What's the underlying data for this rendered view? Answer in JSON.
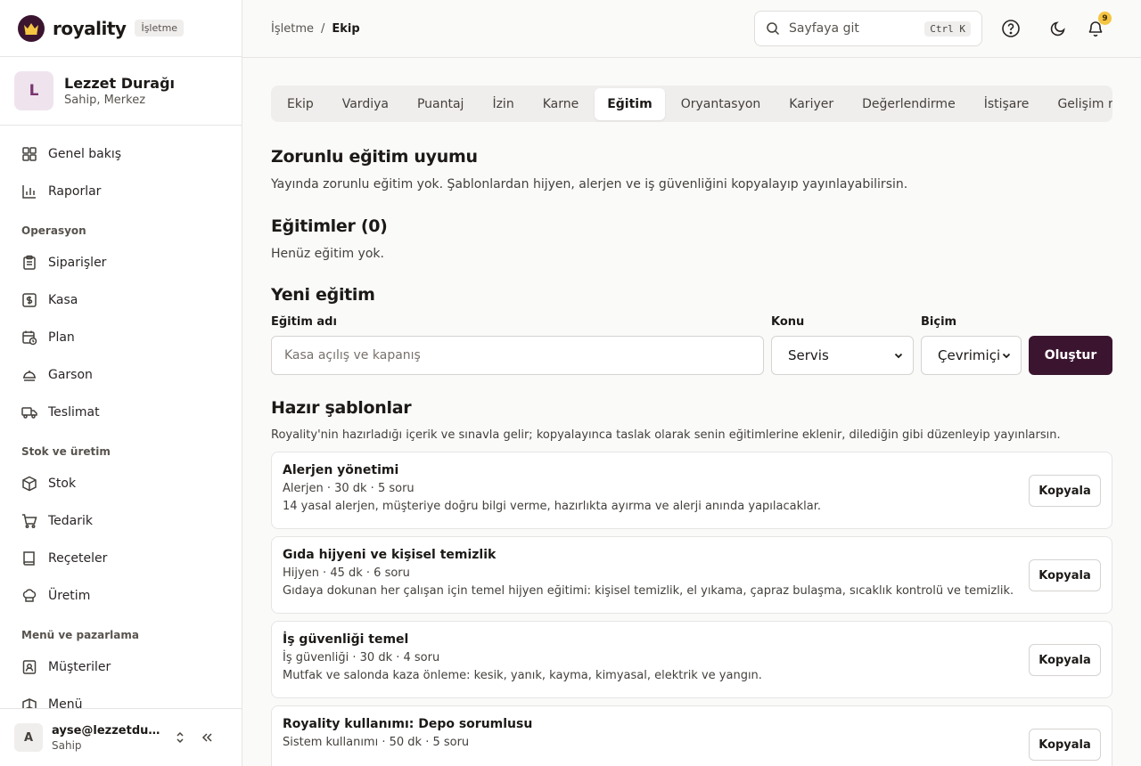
{
  "brand": {
    "name": "royality",
    "badge": "İşletme"
  },
  "org": {
    "initial": "L",
    "name": "Lezzet Durağı",
    "role": "Sahip, Merkez"
  },
  "sidebar": {
    "items_top": [
      {
        "label": "Genel bakış",
        "icon": "dashboard-icon"
      },
      {
        "label": "Raporlar",
        "icon": "bar-chart-icon"
      }
    ],
    "section_operations": "Operasyon",
    "items_operations": [
      {
        "label": "Siparişler",
        "icon": "clipboard-icon"
      },
      {
        "label": "Kasa",
        "icon": "cash-register-icon"
      },
      {
        "label": "Plan",
        "icon": "calendar-clock-icon"
      },
      {
        "label": "Garson",
        "icon": "waiter-icon"
      },
      {
        "label": "Teslimat",
        "icon": "truck-icon"
      }
    ],
    "section_stock": "Stok ve üretim",
    "items_stock": [
      {
        "label": "Stok",
        "icon": "box-icon"
      },
      {
        "label": "Tedarik",
        "icon": "cart-icon"
      },
      {
        "label": "Reçeteler",
        "icon": "book-icon"
      },
      {
        "label": "Üretim",
        "icon": "chef-hat-icon"
      }
    ],
    "section_marketing": "Menü ve pazarlama",
    "items_marketing": [
      {
        "label": "Müşteriler",
        "icon": "contact-icon"
      },
      {
        "label": "Menü",
        "icon": "menu-book-icon"
      }
    ]
  },
  "user": {
    "initial": "A",
    "email": "ayse@lezzetduragi.com",
    "role": "Sahip"
  },
  "header": {
    "breadcrumb_parent": "İşletme",
    "breadcrumb_sep": "/",
    "breadcrumb_current": "Ekip",
    "search_placeholder": "Sayfaya git",
    "search_shortcut": "Ctrl K",
    "notification_count": "9"
  },
  "tabs": [
    {
      "label": "Ekip",
      "active": false
    },
    {
      "label": "Vardiya",
      "active": false
    },
    {
      "label": "Puantaj",
      "active": false
    },
    {
      "label": "İzin",
      "active": false
    },
    {
      "label": "Karne",
      "active": false
    },
    {
      "label": "Eğitim",
      "active": true
    },
    {
      "label": "Oryantasyon",
      "active": false
    },
    {
      "label": "Kariyer",
      "active": false
    },
    {
      "label": "Değerlendirme",
      "active": false
    },
    {
      "label": "İstişare",
      "active": false
    },
    {
      "label": "Gelişim raporu",
      "active": false
    }
  ],
  "compliance": {
    "title": "Zorunlu eğitim uyumu",
    "text": "Yayında zorunlu eğitim yok. Şablonlardan hijyen, alerjen ve iş güvenliğini kopyalayıp yayınlayabilirsin."
  },
  "trainings": {
    "title": "Eğitimler (0)",
    "empty_text": "Henüz eğitim yok."
  },
  "new_training": {
    "title": "Yeni eğitim",
    "name_label": "Eğitim adı",
    "name_placeholder": "Kasa açılış ve kapanış",
    "topic_label": "Konu",
    "topic_value": "Servis",
    "format_label": "Biçim",
    "format_value": "Çevrimiçi",
    "create_label": "Oluştur"
  },
  "templates": {
    "title": "Hazır şablonlar",
    "subtitle": "Royality'nin hazırladığı içerik ve sınavla gelir; kopyalayınca taslak olarak senin eğitimlerine eklenir, dilediğin gibi düzenleyip yayınlarsın.",
    "copy_label": "Kopyala",
    "items": [
      {
        "title": "Alerjen yönetimi",
        "meta": "Alerjen · 30 dk · 5 soru",
        "desc": "14 yasal alerjen, müşteriye doğru bilgi verme, hazırlıkta ayırma ve alerji anında yapılacaklar."
      },
      {
        "title": "Gıda hijyeni ve kişisel temizlik",
        "meta": "Hijyen · 45 dk · 6 soru",
        "desc": "Gıdaya dokunan her çalışan için temel hijyen eğitimi: kişisel temizlik, el yıkama, çapraz bulaşma, sıcaklık kontrolü ve temizlik."
      },
      {
        "title": "İş güvenliği temel",
        "meta": "İş güvenliği · 30 dk · 4 soru",
        "desc": "Mutfak ve salonda kaza önleme: kesik, yanık, kayma, kimyasal, elektrik ve yangın."
      },
      {
        "title": "Royality kullanımı: Depo sorumlusu",
        "meta": "Sistem kullanımı · 50 dk · 5 soru",
        "desc": ""
      }
    ]
  },
  "colors": {
    "accent": "#3b1530",
    "badge": "#f5c542"
  }
}
